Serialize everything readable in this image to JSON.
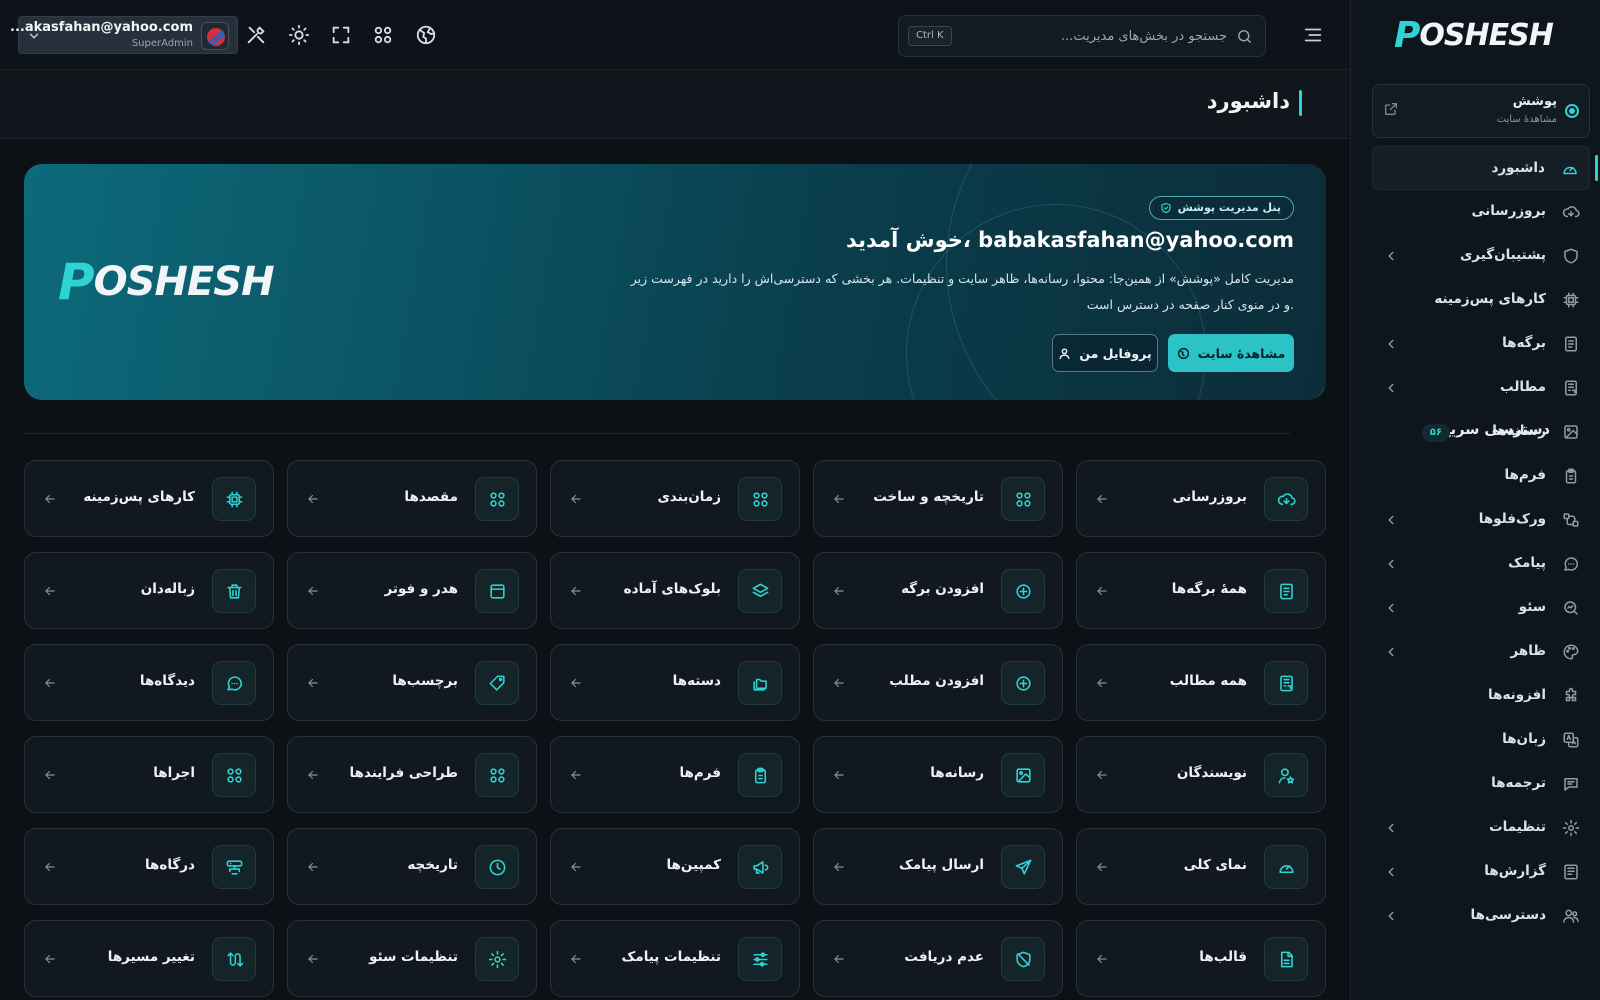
{
  "brand": {
    "logo_text_first": "P",
    "logo_text_rest": "OSHESH"
  },
  "site_card": {
    "title": "پوشش",
    "subtitle": "مشاهدهٔ سایت"
  },
  "sidebar": {
    "items": [
      {
        "label": "داشبورد",
        "icon": "gauge-icon",
        "active": true,
        "chevron": false
      },
      {
        "label": "بروزرسانی",
        "icon": "cloud-download-icon",
        "chevron": false
      },
      {
        "label": "پشتیبان‌گیری",
        "icon": "shield-icon",
        "chevron": true
      },
      {
        "label": "کارهای پس‌زمینه",
        "icon": "cpu-icon",
        "chevron": false
      },
      {
        "label": "برگه‌ها",
        "icon": "page-icon",
        "chevron": true
      },
      {
        "label": "مطالب",
        "icon": "article-icon",
        "chevron": true
      },
      {
        "label": "رسانه‌ها",
        "icon": "image-icon",
        "chevron": false
      },
      {
        "label": "فرم‌ها",
        "icon": "clipboard-icon",
        "chevron": false
      },
      {
        "label": "ورک‌فلوها",
        "icon": "workflow-icon",
        "chevron": true
      },
      {
        "label": "پیامک",
        "icon": "chat-icon",
        "chevron": true
      },
      {
        "label": "سئو",
        "icon": "seo-icon",
        "chevron": true
      },
      {
        "label": "ظاهر",
        "icon": "palette-icon",
        "chevron": true
      },
      {
        "label": "افزونه‌ها",
        "icon": "puzzle-icon",
        "chevron": false
      },
      {
        "label": "زبان‌ها",
        "icon": "language-icon",
        "chevron": false
      },
      {
        "label": "ترجمه‌ها",
        "icon": "comment-icon",
        "chevron": false
      },
      {
        "label": "تنظیمات",
        "icon": "gear-icon",
        "chevron": true
      },
      {
        "label": "گزارش‌ها",
        "icon": "report-icon",
        "chevron": true
      },
      {
        "label": "دسترسی‌ها",
        "icon": "users-icon",
        "chevron": true
      }
    ]
  },
  "topbar": {
    "search_placeholder": "جستجو در بخش‌های مدیریت...",
    "search_value": "",
    "shortcut": "Ctrl K",
    "user_email": "...akasfahan@yahoo.com",
    "user_role": "SuperAdmin"
  },
  "page": {
    "title": "داشبورد"
  },
  "hero": {
    "badge": "پنل مدیریت پوشش",
    "title": "خوش آمدید، babakasfahan@yahoo.com",
    "description": "مدیریت کامل «پوشش» از همین‌جا: محتوا، رسانه‌ها، ظاهر سایت و تنظیمات. هر بخشی که دسترسی‌اش را دارید در فهرست زیر و در منوی کنار صفحه در دسترس است.",
    "primary_button": "مشاهدهٔ سایت",
    "secondary_button": "پروفایل من"
  },
  "quick_access": {
    "title": "دسترسی سریع",
    "count": "۵۶",
    "cards": [
      {
        "label": "بروزرسانی",
        "icon": "cloud-download-icon"
      },
      {
        "label": "تاریخچه و ساخت",
        "icon": "grid-icon"
      },
      {
        "label": "زمان‌بندی",
        "icon": "grid-icon"
      },
      {
        "label": "مقصدها",
        "icon": "grid-icon"
      },
      {
        "label": "کارهای پس‌زمینه",
        "icon": "cpu-icon"
      },
      {
        "label": "همهٔ برگه‌ها",
        "icon": "page-icon"
      },
      {
        "label": "افزودن برگه",
        "icon": "plus-circle-icon"
      },
      {
        "label": "بلوک‌های آماده",
        "icon": "layers-icon"
      },
      {
        "label": "هدر و فوتر",
        "icon": "layout-icon"
      },
      {
        "label": "زباله‌دان",
        "icon": "trash-icon"
      },
      {
        "label": "همه مطالب",
        "icon": "article-icon"
      },
      {
        "label": "افزودن مطلب",
        "icon": "plus-circle-icon"
      },
      {
        "label": "دسته‌ها",
        "icon": "folders-icon"
      },
      {
        "label": "برچسب‌ها",
        "icon": "tag-icon"
      },
      {
        "label": "دیدگاه‌ها",
        "icon": "chat-icon"
      },
      {
        "label": "نویسندگان",
        "icon": "user-star-icon"
      },
      {
        "label": "رسانه‌ها",
        "icon": "image-icon"
      },
      {
        "label": "فرم‌ها",
        "icon": "clipboard-icon"
      },
      {
        "label": "طراحی فرایندها",
        "icon": "grid-icon"
      },
      {
        "label": "اجراها",
        "icon": "grid-icon"
      },
      {
        "label": "نمای کلی",
        "icon": "gauge-icon"
      },
      {
        "label": "ارسال پیامک",
        "icon": "send-icon"
      },
      {
        "label": "کمپین‌ها",
        "icon": "megaphone-icon"
      },
      {
        "label": "تاریخچه",
        "icon": "clock-icon"
      },
      {
        "label": "درگاه‌ها",
        "icon": "gateway-icon"
      },
      {
        "label": "قالب‌ها",
        "icon": "file-icon"
      },
      {
        "label": "عدم دریافت",
        "icon": "shield-off-icon"
      },
      {
        "label": "تنظیمات پیامک",
        "icon": "sliders-icon"
      },
      {
        "label": "تنظیمات سئو",
        "icon": "gear-icon"
      },
      {
        "label": "تغییر مسیرها",
        "icon": "redirect-icon"
      }
    ]
  }
}
